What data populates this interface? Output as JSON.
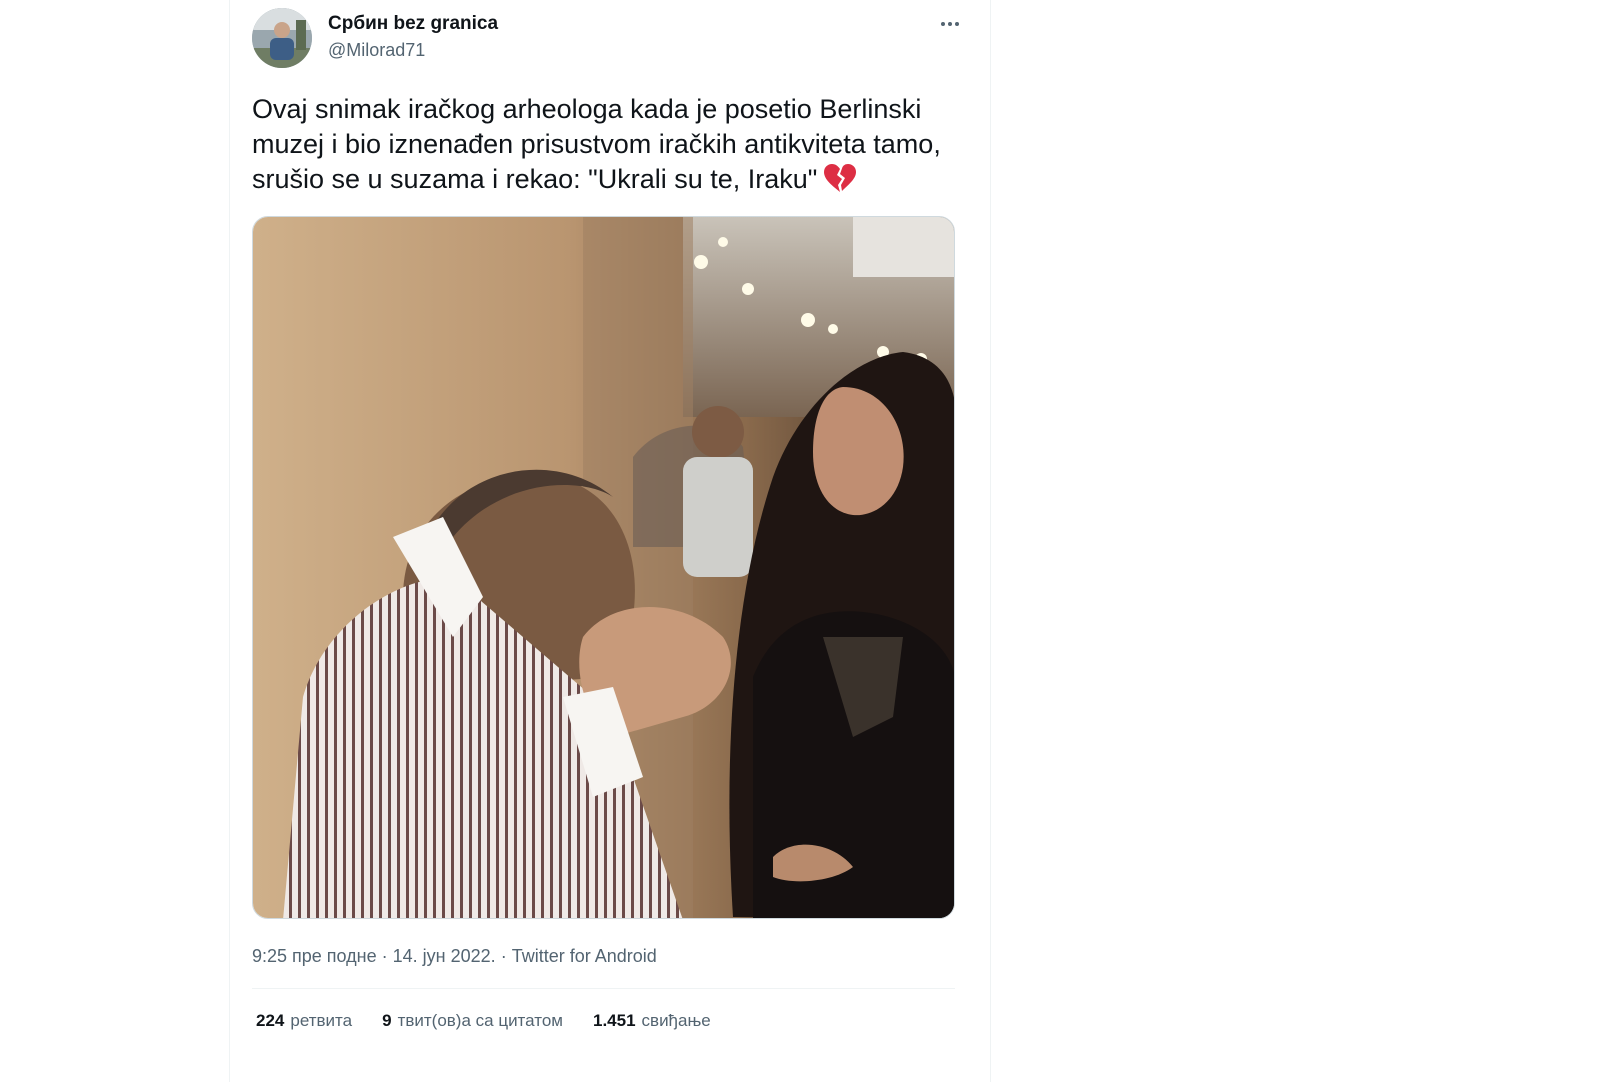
{
  "tweet": {
    "display_name": "Србин bez granica",
    "handle": "@Milorad71",
    "text": "Ovaj snimak iračkog arheologa kada je posetio Berlinski muzej i bio iznenađen prisustvom iračkih antikviteta tamo, srušio se u suzama i rekao: \"Ukrali su te, Iraku\"",
    "emoji_icon": "broken-heart-icon",
    "time": "9:25 пре подне",
    "date": "14. јун 2022.",
    "source": "Twitter for Android",
    "separator": "·"
  },
  "stats": {
    "retweets_count": "224",
    "retweets_label": "ретвита",
    "quotes_count": "9",
    "quotes_label": "твит(ов)а са цитатом",
    "likes_count": "1.451",
    "likes_label": "свиђање"
  },
  "colors": {
    "text_primary": "#0f1419",
    "text_secondary": "#536471",
    "border": "#eff3f4",
    "emoji_red": "#dd2e44"
  }
}
